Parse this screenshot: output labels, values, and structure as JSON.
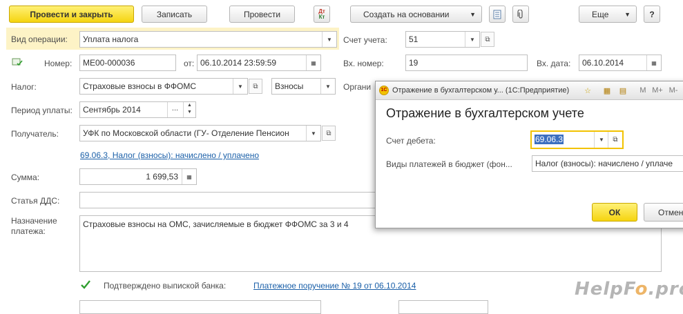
{
  "toolbar": {
    "post_and_close": "Провести и закрыть",
    "save": "Записать",
    "post": "Провести",
    "dtkt_top": "Дт",
    "dtkt_bottom": "Кт",
    "create_based": "Создать на основании",
    "more": "Еще",
    "help": "?"
  },
  "form": {
    "operation_label": "Вид операции:",
    "operation_value": "Уплата налога",
    "account_label": "Счет учета:",
    "account_value": "51",
    "number_label": "Номер:",
    "number_value": "МЕ00-000036",
    "from_label": "от:",
    "date_value": "06.10.2014 23:59:59",
    "in_number_label": "Вх. номер:",
    "in_number_value": "19",
    "in_date_label": "Вх. дата:",
    "in_date_value": "06.10.2014",
    "tax_label": "Налог:",
    "tax_value": "Страховые взносы в ФФОМС",
    "tax_kind_value": "Взносы",
    "org_label": "Органи",
    "period_label": "Период уплаты:",
    "period_value": "Сентябрь 2014",
    "period_dots": "...",
    "recipient_label": "Получатель:",
    "recipient_value": "УФК по Московской области (ГУ- Отделение Пенсион",
    "account_link": "69.06.3, Налог (взносы): начислено / уплачено",
    "sum_label": "Сумма:",
    "sum_value": "1 699,53",
    "dds_label": "Статья ДДС:",
    "dds_value": "",
    "purpose_label_1": "Назначение",
    "purpose_label_2": "платежа:",
    "purpose_value": "Страховые взносы на ОМС, зачисляемые в бюджет ФФОМС за 3 и 4",
    "confirmed_label": "Подтверждено выпиской банка:",
    "payment_link": "Платежное поручение № 19 от 06.10.2014"
  },
  "dialog": {
    "window_title": "Отражение в бухгалтерском у... (1С:Предприятие)",
    "menu_m": "M",
    "menu_mplus": "M+",
    "menu_mminus": "M-",
    "heading": "Отражение в бухгалтерском учете",
    "debit_label": "Счет дебета:",
    "debit_value": "69.06.3",
    "payments_label": "Виды платежей в бюджет (фон...",
    "payments_value": "Налог (взносы): начислено / уплаче",
    "ok": "ОК",
    "cancel": "Отмен"
  },
  "watermark": {
    "brand": "HelpF",
    "brand2": "o",
    "brand3": ".pro"
  },
  "colors": {
    "accent": "#f5d410",
    "highlight_row": "#fdf3c6",
    "link": "#1a5fa8",
    "check": "#2e9e2e",
    "focus_border": "#f2c200",
    "selection": "#3c6fbf"
  }
}
